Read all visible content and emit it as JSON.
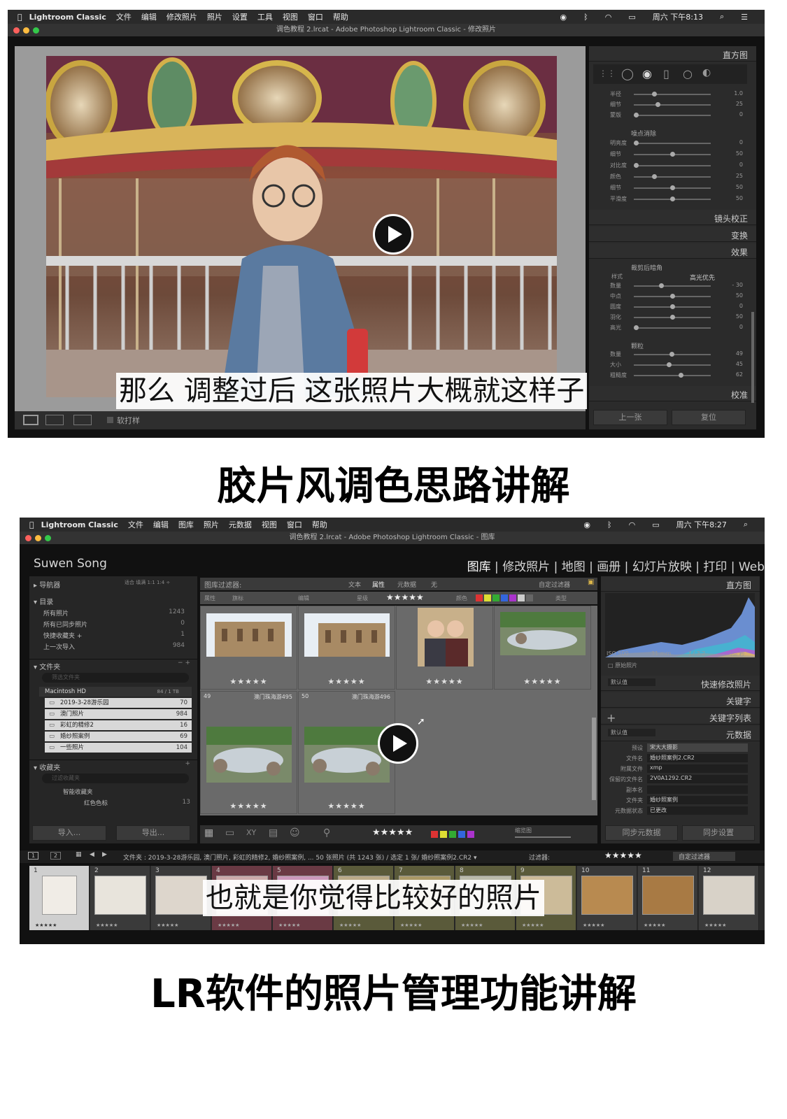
{
  "shot1": {
    "menubar": {
      "app": "Lightroom Classic",
      "items": [
        "文件",
        "编辑",
        "修改照片",
        "照片",
        "设置",
        "工具",
        "视图",
        "窗口",
        "帮助"
      ],
      "clock": "周六 下午8:13"
    },
    "window_title": "调色教程 2.lrcat - Adobe Photoshop Lightroom Classic - 修改照片",
    "panel": {
      "histogram_label": "直方图",
      "sharpen_rows": [
        {
          "label": "半径",
          "value": "1.0",
          "level": 0.25
        },
        {
          "label": "细节",
          "value": "25",
          "level": 0.3
        },
        {
          "label": "蒙版",
          "value": "0",
          "level": 0.0
        }
      ],
      "noise_header": "噪点消除",
      "noise_rows": [
        {
          "label": "明亮度",
          "value": "0",
          "level": 0.0
        },
        {
          "label": "细节",
          "value": "50",
          "level": 0.5
        },
        {
          "label": "对比度",
          "value": "0",
          "level": 0.0
        },
        {
          "label": "颜色",
          "value": "25",
          "level": 0.25
        },
        {
          "label": "细节",
          "value": "50",
          "level": 0.5
        },
        {
          "label": "平滑度",
          "value": "50",
          "level": 0.5
        }
      ],
      "lens_label": "镜头校正",
      "transform_label": "变换",
      "effects_label": "效果",
      "vignette_header": "裁剪后暗角",
      "style_label": "样式",
      "style_value": "高光优先",
      "vignette_rows": [
        {
          "label": "数量",
          "value": "- 30",
          "level": 0.35
        },
        {
          "label": "中点",
          "value": "50",
          "level": 0.5
        },
        {
          "label": "圆度",
          "value": "0",
          "level": 0.5
        },
        {
          "label": "羽化",
          "value": "50",
          "level": 0.5
        },
        {
          "label": "高光",
          "value": "0",
          "level": 0.0
        }
      ],
      "grain_header": "颗粒",
      "grain_rows": [
        {
          "label": "数量",
          "value": "49",
          "level": 0.49
        },
        {
          "label": "大小",
          "value": "45",
          "level": 0.45
        },
        {
          "label": "粗糙度",
          "value": "62",
          "level": 0.62
        }
      ],
      "calibration_label": "校准",
      "prev_button": "上一张",
      "reset_button": "复位"
    },
    "toolbar": {
      "soft_proof": "软打样"
    },
    "subtitle": "那么 调整过后 这张照片大概就这样子"
  },
  "caption1": "胶片风调色思路讲解",
  "shot2": {
    "menubar": {
      "app": "Lightroom Classic",
      "items": [
        "文件",
        "编辑",
        "图库",
        "照片",
        "元数据",
        "视图",
        "窗口",
        "帮助"
      ],
      "clock": "周六 下午8:27"
    },
    "window_title": "调色教程 2.lrcat - Adobe Photoshop Lightroom Classic - 图库",
    "identity": "Suwen Song",
    "modules": [
      "图库",
      "修改照片",
      "地图",
      "画册",
      "幻灯片放映",
      "打印",
      "Web"
    ],
    "left": {
      "navigator": "导航器",
      "nav_opts": "适合  填满  1:1  1:4 ÷",
      "catalog": "目录",
      "catalog_rows": [
        {
          "label": "所有照片",
          "count": "1243"
        },
        {
          "label": "所有已同步照片",
          "count": "0"
        },
        {
          "label": "快捷收藏夹 +",
          "count": "1"
        },
        {
          "label": "上一次导入",
          "count": "984"
        }
      ],
      "folders": "文件夹",
      "search_placeholder": "筛选文件夹",
      "volume": "Macintosh HD",
      "volume_info": "84 / 1 TB",
      "folder_rows": [
        {
          "label": "2019-3-28游乐园",
          "count": "70"
        },
        {
          "label": "澳门照片",
          "count": "984"
        },
        {
          "label": "彩虹的精修2",
          "count": "16"
        },
        {
          "label": "婚纱照案例",
          "count": "69"
        },
        {
          "label": "一些照片",
          "count": "104"
        }
      ],
      "collections": "收藏夹",
      "collections_placeholder": "过滤收藏夹",
      "smart_collections": "智能收藏夹",
      "red_label": "红色色标",
      "red_count": "13",
      "import_button": "导入...",
      "export_button": "导出..."
    },
    "filter_bar": {
      "label": "图库过滤器:",
      "tabs": [
        "文本",
        "属性",
        "元数据",
        "无"
      ],
      "custom": "自定过滤器",
      "attr_labels": [
        "属性",
        "旗标",
        "编辑",
        "星级",
        "颜色",
        "类型"
      ],
      "stars": "★★★★★"
    },
    "grid": {
      "row1_stars": [
        "★★★★★",
        "★★★★★",
        "★★★★★",
        "★★★★★"
      ],
      "row2": [
        {
          "index": "49",
          "name": "澳门珠海游495",
          "stars": "★★★★★"
        },
        {
          "index": "50",
          "name": "澳门珠海游496",
          "stars": "★★★★★"
        }
      ]
    },
    "bottom_toolbar": {
      "stars": "★★★★★",
      "thumb_label": "缩览图"
    },
    "right": {
      "histogram": "直方图",
      "iso": "ISO 500",
      "focal": "31 mm",
      "aperture": "ƒ / 3.2",
      "shutter": "¹⁄₃₀ 秒",
      "original": "原始照片",
      "preset_default": "默认值",
      "quick_develop": "快速修改照片",
      "keywording": "关键字",
      "keyword_list": "关键字列表",
      "metadata_default": "默认值",
      "metadata": "元数据",
      "meta_rows": [
        {
          "label": "预设",
          "value": "宋大大摄影"
        },
        {
          "label": "文件名",
          "value": "婚纱照案例2.CR2"
        },
        {
          "label": "附属文件",
          "value": "xmp"
        },
        {
          "label": "保留的文件名",
          "value": "2V0A1292.CR2"
        },
        {
          "label": "副本名",
          "value": ""
        },
        {
          "label": "文件夹",
          "value": "婚纱照案例"
        },
        {
          "label": "元数据状态",
          "value": "已更改"
        }
      ],
      "sync_meta": "同步元数据",
      "sync_settings": "同步设置"
    },
    "filmstrip_bar": {
      "path": "文件夹 : 2019-3-28游乐园, 澳门照片, 彩虹的精修2, 婚纱照案例, ...  50 张照片 (共 1243 张) / 选定 1 张/ 婚纱照案例2.CR2 ▾",
      "filter_label": "过滤器:",
      "stars": "★★★★★",
      "custom": "自定过滤器"
    },
    "filmstrip_numbers": [
      "1",
      "2",
      "3",
      "4",
      "5",
      "6",
      "7",
      "8",
      "9",
      "10",
      "11",
      "12"
    ],
    "subtitle": "也就是你觉得比较好的照片"
  },
  "caption2": "LR软件的照片管理功能讲解",
  "colors": {
    "accent": "#4a90e2",
    "panel": "#2b2b2b",
    "stage": "#6b6b6b"
  }
}
